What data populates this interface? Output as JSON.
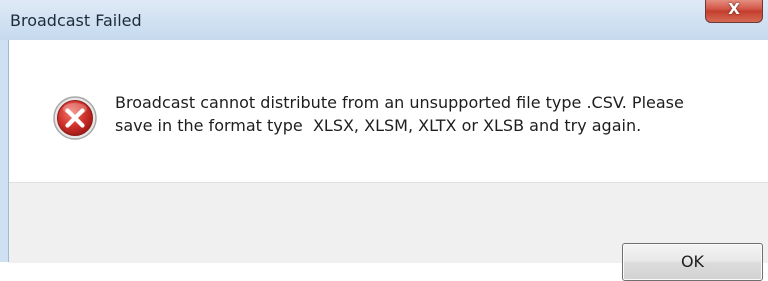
{
  "window": {
    "title": "Broadcast Failed",
    "close_label": "X"
  },
  "icon": {
    "name": "error-icon",
    "color": "#c9262a"
  },
  "message": {
    "line1": "Broadcast cannot distribute from an unsupported file type .CSV. Please",
    "line2": "save in the format type  XLSX, XLSM, XLTX or XLSB and try again."
  },
  "buttons": {
    "ok_label": "OK"
  }
}
